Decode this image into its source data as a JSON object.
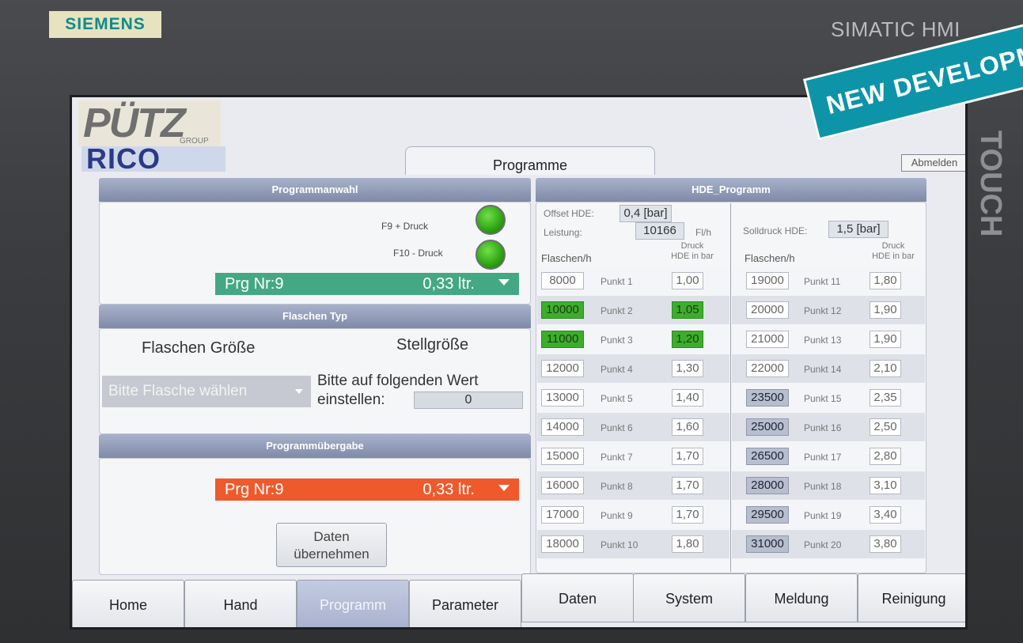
{
  "device": {
    "brand": "SIEMENS",
    "model": "SIMATIC HMI",
    "side_label": "TOUCH"
  },
  "overlay": {
    "banner": "NEW DEVELOPM"
  },
  "header": {
    "logo_top": "PÜTZ",
    "logo_group": "GROUP",
    "logo_bottom": "RICO",
    "title": "Programme",
    "logout": "Abmelden"
  },
  "programmanwahl": {
    "header": "Programmanwahl",
    "f9_label": "F9 + Druck",
    "f10_label": "F10 - Druck",
    "program": "Prg Nr:9",
    "volume": "0,33 ltr."
  },
  "flaschen_typ": {
    "header": "Flaschen Typ",
    "size_label": "Flaschen Größe",
    "adjust_label": "Stellgröße",
    "select_placeholder": "Bitte Flasche wählen",
    "hint_line1": "Bitte auf folgenden Wert",
    "hint_line2": "einstellen:",
    "value": "0"
  },
  "programmuebergabe": {
    "header": "Programmübergabe",
    "program": "Prg Nr:9",
    "volume": "0,33 ltr.",
    "apply_line1": "Daten",
    "apply_line2": "übernehmen"
  },
  "hde": {
    "header": "HDE_Programm",
    "offset_label": "Offset HDE:",
    "offset_value": "0,4 [bar]",
    "leistung_label": "Leistung:",
    "leistung_value": "10166",
    "leistung_unit": "Fl/h",
    "solldruck_label": "Solldruck HDE:",
    "solldruck_value": "1,5 [bar]",
    "col_flaschen": "Flaschen/h",
    "col_druck_1": "Druck",
    "col_druck_2": "HDE in bar",
    "left_rows": [
      {
        "flaschen": "8000",
        "punkt": "Punkt 1",
        "druck": "1,00",
        "state": "normal"
      },
      {
        "flaschen": "10000",
        "punkt": "Punkt 2",
        "druck": "1,05",
        "state": "green"
      },
      {
        "flaschen": "11000",
        "punkt": "Punkt 3",
        "druck": "1,20",
        "state": "green"
      },
      {
        "flaschen": "12000",
        "punkt": "Punkt 4",
        "druck": "1,30",
        "state": "normal"
      },
      {
        "flaschen": "13000",
        "punkt": "Punkt 5",
        "druck": "1,40",
        "state": "normal"
      },
      {
        "flaschen": "14000",
        "punkt": "Punkt 6",
        "druck": "1,60",
        "state": "normal"
      },
      {
        "flaschen": "15000",
        "punkt": "Punkt 7",
        "druck": "1,70",
        "state": "normal"
      },
      {
        "flaschen": "16000",
        "punkt": "Punkt 8",
        "druck": "1,70",
        "state": "normal"
      },
      {
        "flaschen": "17000",
        "punkt": "Punkt 9",
        "druck": "1,70",
        "state": "normal"
      },
      {
        "flaschen": "18000",
        "punkt": "Punkt 10",
        "druck": "1,80",
        "state": "normal"
      }
    ],
    "right_rows": [
      {
        "flaschen": "19000",
        "punkt": "Punkt 11",
        "druck": "1,80",
        "state": "normal"
      },
      {
        "flaschen": "20000",
        "punkt": "Punkt 12",
        "druck": "1,90",
        "state": "normal"
      },
      {
        "flaschen": "21000",
        "punkt": "Punkt 13",
        "druck": "1,90",
        "state": "normal"
      },
      {
        "flaschen": "22000",
        "punkt": "Punkt 14",
        "druck": "2,10",
        "state": "normal"
      },
      {
        "flaschen": "23500",
        "punkt": "Punkt 15",
        "druck": "2,35",
        "state": "grey"
      },
      {
        "flaschen": "25000",
        "punkt": "Punkt 16",
        "druck": "2,50",
        "state": "grey"
      },
      {
        "flaschen": "26500",
        "punkt": "Punkt 17",
        "druck": "2,80",
        "state": "grey"
      },
      {
        "flaschen": "28000",
        "punkt": "Punkt 18",
        "druck": "3,10",
        "state": "grey"
      },
      {
        "flaschen": "29500",
        "punkt": "Punkt 19",
        "druck": "3,40",
        "state": "grey"
      },
      {
        "flaschen": "31000",
        "punkt": "Punkt 20",
        "druck": "3,80",
        "state": "grey"
      }
    ]
  },
  "nav": [
    {
      "label": "Home",
      "active": false
    },
    {
      "label": "Hand",
      "active": false
    },
    {
      "label": "Programm",
      "active": true
    },
    {
      "label": "Parameter",
      "active": false
    },
    {
      "label": "Daten",
      "active": false
    },
    {
      "label": "System",
      "active": false
    },
    {
      "label": "Meldung",
      "active": false
    },
    {
      "label": "Reinigung",
      "active": false
    }
  ],
  "colors": {
    "led_on": "#2ea312",
    "program_select": "#43a883",
    "program_transfer": "#ee5a2c",
    "highlight_green": "#3dae2b",
    "highlight_grey": "#b7bfcf",
    "section_header": "#8e99b6"
  }
}
